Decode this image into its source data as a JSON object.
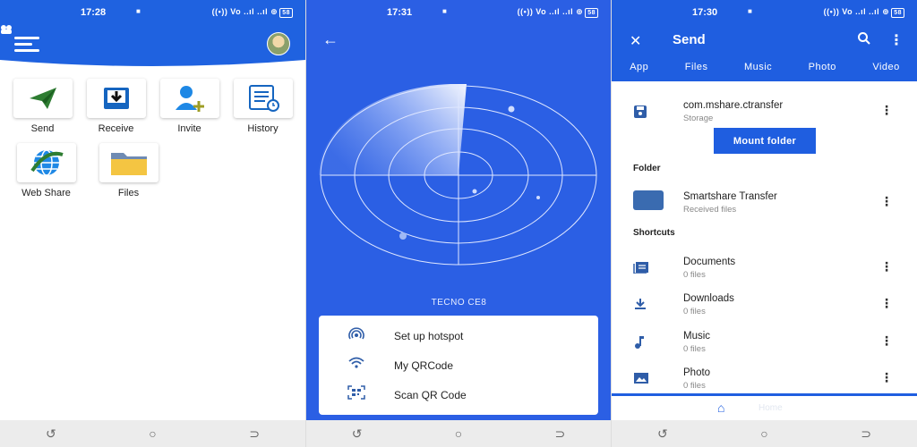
{
  "panel1": {
    "status": {
      "time": "17:28",
      "right": "((•)) Vo ..ıl ..ıl ⊕",
      "battery": "58"
    },
    "tiles": [
      {
        "label": "Send",
        "icon": "paper-plane-icon"
      },
      {
        "label": "Receive",
        "icon": "download-tray-icon"
      },
      {
        "label": "Invite",
        "icon": "add-user-icon"
      },
      {
        "label": "History",
        "icon": "history-icon"
      },
      {
        "label": "Web Share",
        "icon": "globe-icon"
      },
      {
        "label": "Files",
        "icon": "folder-icon"
      }
    ],
    "colors": {
      "header": "#1f62e0"
    }
  },
  "panel2": {
    "status": {
      "time": "17:31",
      "right": "((•)) Vo ..ıl ..ıl ⊕",
      "battery": "58"
    },
    "device": "TECNO CE8",
    "menu": [
      {
        "label": "Set up hotspot",
        "icon": "hotspot-icon"
      },
      {
        "label": "My QRCode",
        "icon": "wifi-icon"
      },
      {
        "label": "Scan QR Code",
        "icon": "qr-scan-icon"
      }
    ],
    "colors": {
      "background": "#2b5fe4"
    }
  },
  "panel3": {
    "status": {
      "time": "17:30",
      "right": "((•)) Vo ..ıl ..ıl ⊕",
      "battery": "58"
    },
    "title": "Send",
    "tabs": [
      "App",
      "Files",
      "Music",
      "Photo",
      "Video"
    ],
    "storage": {
      "name": "com.mshare.ctransfer",
      "sub": "Storage"
    },
    "mount_button": "Mount folder",
    "folder_heading": "Folder",
    "folder": {
      "name": "Smartshare Transfer",
      "sub": "Received files"
    },
    "shortcuts_heading": "Shortcuts",
    "shortcuts": [
      {
        "name": "Documents",
        "sub": "0 files",
        "icon": "documents-icon"
      },
      {
        "name": "Downloads",
        "sub": "0 files",
        "icon": "download-icon"
      },
      {
        "name": "Music",
        "sub": "0 files",
        "icon": "music-note-icon"
      },
      {
        "name": "Photo",
        "sub": "0 files",
        "icon": "image-icon"
      }
    ],
    "bottom_tab": "Home",
    "colors": {
      "header": "#1f5ee0"
    }
  }
}
